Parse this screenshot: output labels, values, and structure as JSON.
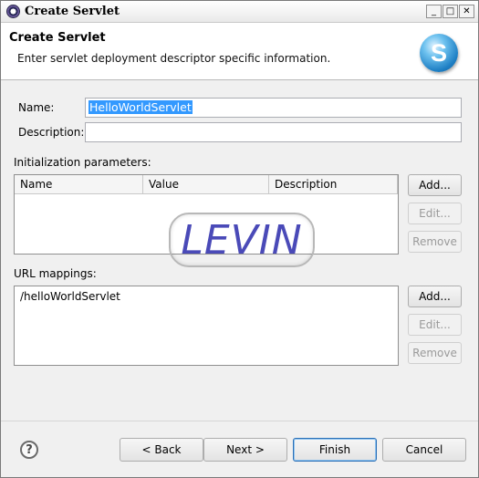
{
  "window": {
    "title": "Create Servlet",
    "min_glyph": "_",
    "max_glyph": "□",
    "close_glyph": "✕"
  },
  "header": {
    "title": "Create Servlet",
    "subtitle": "Enter servlet deployment descriptor specific information.",
    "logo_letter": "S"
  },
  "form": {
    "name_label": "Name:",
    "name_value": "HelloWorldServlet",
    "description_label": "Description:",
    "description_value": ""
  },
  "init_params": {
    "label": "Initialization parameters:",
    "columns": [
      "Name",
      "Value",
      "Description"
    ],
    "rows": [],
    "buttons": {
      "add": "Add...",
      "edit": "Edit...",
      "remove": "Remove"
    }
  },
  "url_mappings": {
    "label": "URL mappings:",
    "rows": [
      "/helloWorldServlet"
    ],
    "buttons": {
      "add": "Add...",
      "edit": "Edit...",
      "remove": "Remove"
    }
  },
  "watermark": "LEVIN",
  "footer": {
    "help_glyph": "?",
    "back": "< Back",
    "next": "Next >",
    "finish": "Finish",
    "cancel": "Cancel"
  }
}
